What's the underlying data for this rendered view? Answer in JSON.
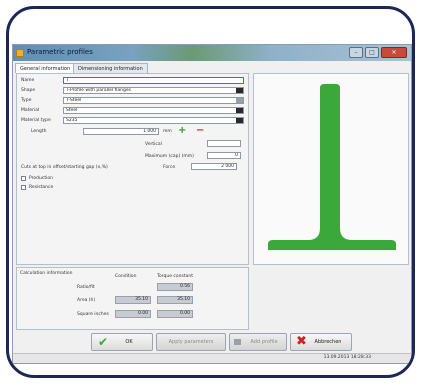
{
  "window": {
    "title": "Parametric profiles",
    "buttons": {
      "minimize": "–",
      "maximize": "□",
      "close": "✕"
    }
  },
  "tabs": [
    {
      "label": "General information"
    },
    {
      "label": "Dimensioning information"
    }
  ],
  "form": {
    "name_label": "Name",
    "name_value": "T",
    "shape_label": "Shape",
    "shape_value": "T-Profile with parallel flanges",
    "type_label": "Type",
    "type_value": "T-Steel",
    "material_label": "Material",
    "material_value": "Steel",
    "material_type_label": "Material type",
    "material_type_value": "S235",
    "length_label": "Length",
    "length_value": "1 000",
    "length_unit": "mm",
    "vertical_label": "Vertical",
    "vertical_value": "",
    "maximum_label": "Maximum (cap) (mm)",
    "maximum_value": "0",
    "group_label": "Cuts at top in offset/starting gap (x,%)",
    "force_label": "Force",
    "force_value": "2 000",
    "check1_label": "Production",
    "check2_label": "Resistance"
  },
  "calc": {
    "title": "Calculation information",
    "col1": "Condition",
    "col2": "Torque constant",
    "rows": [
      {
        "label": "Ratio/fit",
        "v1": "",
        "v2": "0.56"
      },
      {
        "label": "Area (h)",
        "v1": "35.10",
        "v2": "35.10"
      },
      {
        "label": "Square inches",
        "v1": "0.00",
        "v2": "0.00"
      }
    ]
  },
  "buttons": {
    "ok": "OK",
    "apply": "Apply parameters",
    "add": "Add profile",
    "cancel": "Abbrechen"
  },
  "status": {
    "text": "13.09.2013  18:28:33"
  },
  "colors": {
    "profile_fill": "#3aa83a",
    "accent": "#3b73c4"
  }
}
